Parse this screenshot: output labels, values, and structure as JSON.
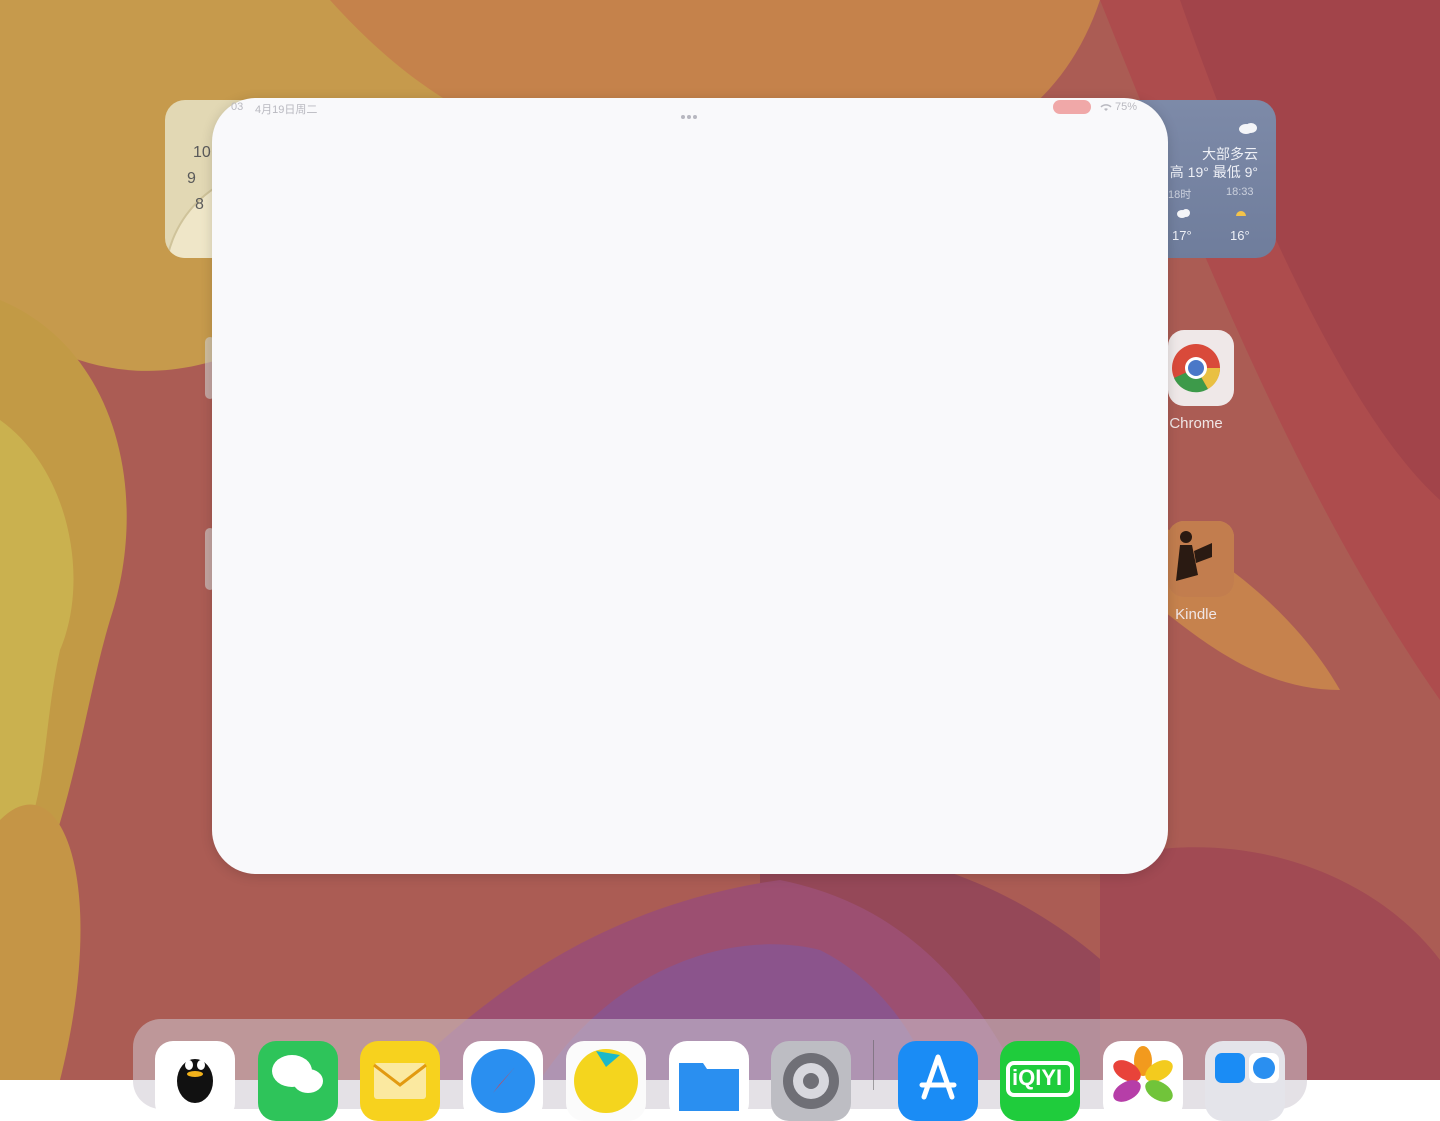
{
  "status_bar": {
    "time": "03",
    "date": "4月19日周二",
    "battery": "75%"
  },
  "clock_widget": {
    "numbers": [
      "10",
      "9",
      "8"
    ]
  },
  "weather_widget": {
    "condition": "大部多云",
    "high_low": "高 19° 最低 9°",
    "forecast": [
      {
        "time": "18时",
        "temp": "17°"
      },
      {
        "time": "18:33",
        "temp": "16°"
      }
    ]
  },
  "apps": [
    {
      "label": "Chrome"
    },
    {
      "label": "Kindle"
    }
  ],
  "dock": {
    "apps": [
      "QQ",
      "WeChat",
      "Mail",
      "Safari",
      "Maps",
      "Files",
      "Settings",
      "App Store",
      "iQIYI",
      "Photos",
      "Recent"
    ],
    "iqiyi_text": "iQIYI"
  },
  "colors": {
    "accent_red": "#f0a8a8",
    "window_bg": "#f9f9fb"
  }
}
